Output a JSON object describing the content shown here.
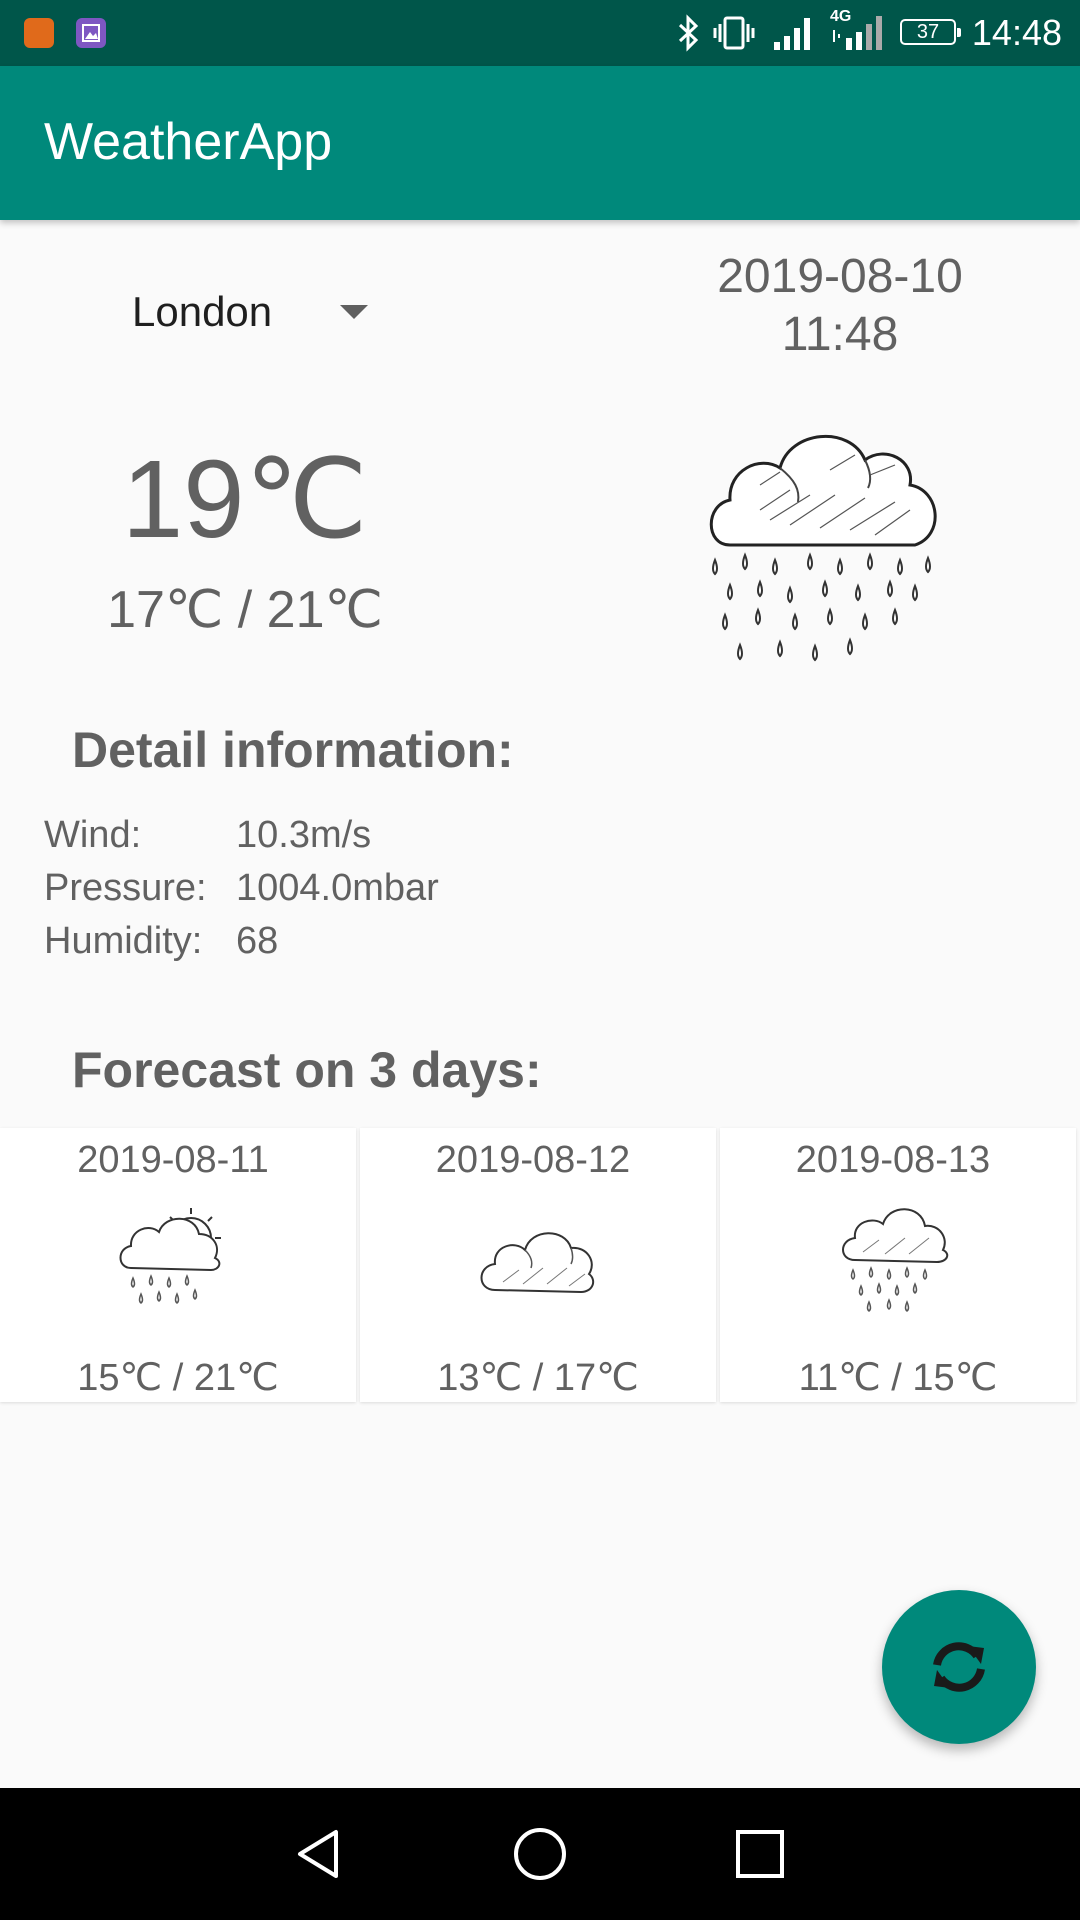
{
  "status_bar": {
    "time": "14:48",
    "battery": "37",
    "network_type": "4G",
    "icons": [
      "mi-app-icon",
      "gallery-app-icon",
      "bluetooth-icon",
      "vibrate-icon",
      "signal-icon",
      "signal-4g-icon",
      "battery-icon"
    ]
  },
  "app_bar": {
    "title": "WeatherApp",
    "color": "#00897b"
  },
  "current": {
    "city": "London",
    "date": "2019-08-10",
    "time": "11:48",
    "temperature": "19℃",
    "min_max": "17℃ / 21℃",
    "icon": "rain-cloud-icon"
  },
  "details": {
    "title": "Detail information:",
    "rows": [
      {
        "label": "Wind:",
        "value": "10.3m/s"
      },
      {
        "label": "Pressure:",
        "value": "1004.0mbar"
      },
      {
        "label": "Humidity:",
        "value": "68"
      }
    ]
  },
  "forecast": {
    "title": "Forecast on 3 days:",
    "days": [
      {
        "date": "2019-08-11",
        "temps": "15℃ / 21℃",
        "icon": "sun-rain-cloud-icon"
      },
      {
        "date": "2019-08-12",
        "temps": "13℃ / 17℃",
        "icon": "cloud-icon"
      },
      {
        "date": "2019-08-13",
        "temps": "11℃ / 15℃",
        "icon": "rain-cloud-icon"
      }
    ]
  },
  "fab": {
    "icon": "refresh-icon"
  },
  "nav_bar": {
    "buttons": [
      "back-icon",
      "home-icon",
      "recents-icon"
    ]
  }
}
